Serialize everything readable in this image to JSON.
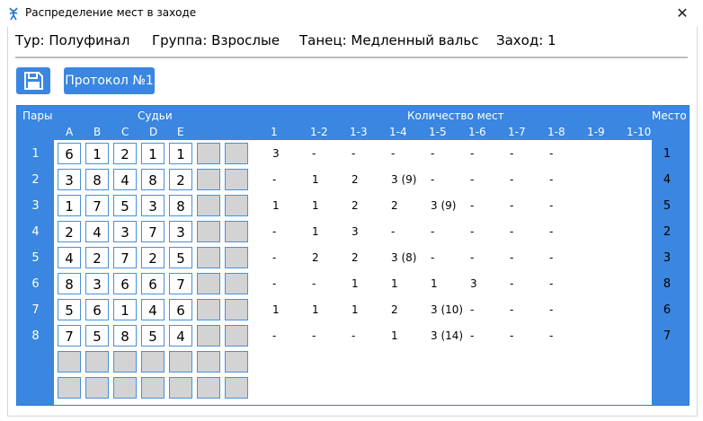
{
  "window": {
    "title": "Распределение мест в заходе",
    "close_glyph": "✕"
  },
  "info": {
    "round": "Тур: Полуфинал",
    "group": "Группа: Взрослые",
    "dance": "Танец: Медленный вальс",
    "heat": "Заход: 1"
  },
  "toolbar": {
    "save_icon": "save-icon",
    "protocol_label": "Протокол №1"
  },
  "table": {
    "headers": {
      "pairs": "Пары",
      "judges": "Судьи",
      "count": "Количество мест",
      "place": "Место"
    },
    "judges": [
      "A",
      "B",
      "C",
      "D",
      "E"
    ],
    "count_columns": [
      "1",
      "1-2",
      "1-3",
      "1-4",
      "1-5",
      "1-6",
      "1-7",
      "1-8",
      "1-9",
      "1-10"
    ],
    "rows": [
      {
        "pair": "1",
        "marks": [
          "6",
          "1",
          "2",
          "1",
          "1"
        ],
        "counts": [
          "3",
          "-",
          "-",
          "-",
          "-",
          "-",
          "-",
          "-",
          "",
          ""
        ],
        "place": "1"
      },
      {
        "pair": "2",
        "marks": [
          "3",
          "8",
          "4",
          "8",
          "2"
        ],
        "counts": [
          "-",
          "1",
          "2",
          "3 (9)",
          "-",
          "-",
          "-",
          "-",
          "",
          ""
        ],
        "place": "4"
      },
      {
        "pair": "3",
        "marks": [
          "1",
          "7",
          "5",
          "3",
          "8"
        ],
        "counts": [
          "1",
          "1",
          "2",
          "2",
          "3 (9)",
          "-",
          "-",
          "-",
          "",
          ""
        ],
        "place": "5"
      },
      {
        "pair": "4",
        "marks": [
          "2",
          "4",
          "3",
          "7",
          "3"
        ],
        "counts": [
          "-",
          "1",
          "3",
          "-",
          "-",
          "-",
          "-",
          "-",
          "",
          ""
        ],
        "place": "2"
      },
      {
        "pair": "5",
        "marks": [
          "4",
          "2",
          "7",
          "2",
          "5"
        ],
        "counts": [
          "-",
          "2",
          "2",
          "3 (8)",
          "-",
          "-",
          "-",
          "-",
          "",
          ""
        ],
        "place": "3"
      },
      {
        "pair": "6",
        "marks": [
          "8",
          "3",
          "6",
          "6",
          "7"
        ],
        "counts": [
          "-",
          "-",
          "1",
          "1",
          "1",
          "3",
          "-",
          "-",
          "",
          ""
        ],
        "place": "8"
      },
      {
        "pair": "7",
        "marks": [
          "5",
          "6",
          "1",
          "4",
          "6"
        ],
        "counts": [
          "1",
          "1",
          "1",
          "2",
          "3 (10)",
          "-",
          "-",
          "-",
          "",
          ""
        ],
        "place": "6"
      },
      {
        "pair": "8",
        "marks": [
          "7",
          "5",
          "8",
          "5",
          "4"
        ],
        "counts": [
          "-",
          "-",
          "-",
          "1",
          "3 (14)",
          "-",
          "-",
          "-",
          "",
          ""
        ],
        "place": "7"
      }
    ],
    "empty_rows": 2
  }
}
